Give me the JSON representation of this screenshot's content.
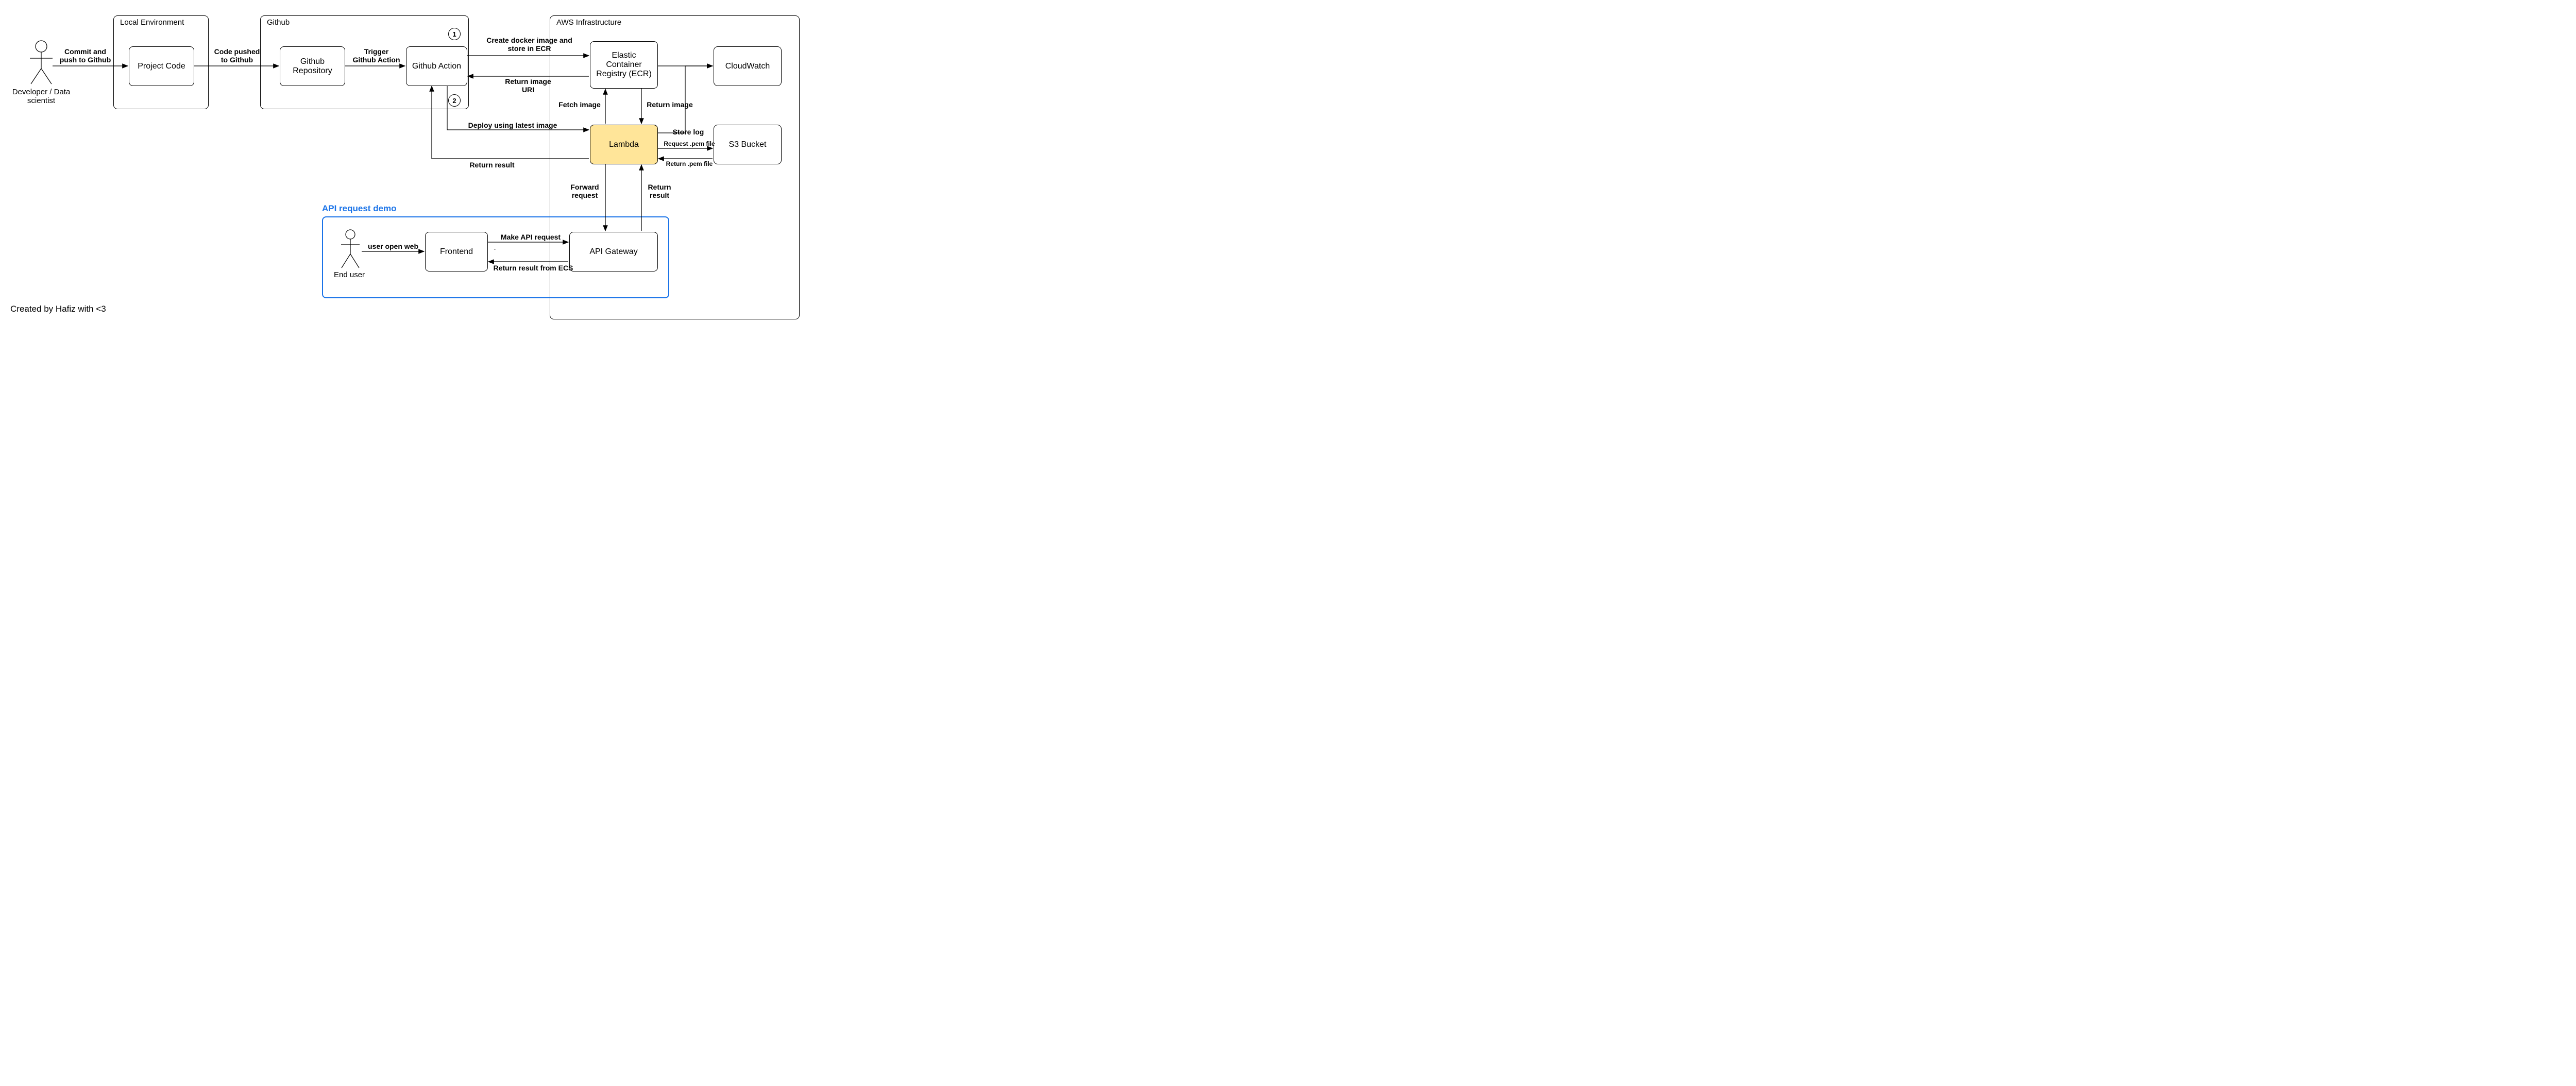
{
  "actors": {
    "developer": "Developer / Data\nscientist",
    "enduser": "End user"
  },
  "groups": {
    "local": "Local Environment",
    "github": "Github",
    "aws": "AWS Infrastructure",
    "api_demo": "API request demo"
  },
  "nodes": {
    "project_code": "Project Code",
    "github_repo": "Github\nRepository",
    "github_action": "Github Action",
    "ecr": "Elastic\nContainer\nRegistry (ECR)",
    "cloudwatch": "CloudWatch",
    "lambda": "Lambda",
    "s3": "S3 Bucket",
    "frontend": "Frontend",
    "api_gateway": "API Gateway",
    "tick": "`"
  },
  "edges": {
    "commit": "Commit and\npush to Github",
    "code_pushed": "Code pushed\nto Github",
    "trigger": "Trigger\nGithub Action",
    "create_img": "Create docker image and\nstore in ECR",
    "return_uri": "Return image\nURI",
    "fetch_img": "Fetch image",
    "return_img": "Return image",
    "deploy": "Deploy using latest image",
    "return_result_ga": "Return result",
    "store_log": "Store log",
    "req_pem": "Request .pem file",
    "ret_pem": "Return .pem file",
    "fwd_req": "Forward\nrequest",
    "ret_result": "Return\nresult",
    "user_open": "user open web",
    "make_api": "Make API request",
    "ret_ecs": "Return result from ECS"
  },
  "steps": {
    "s1": "1",
    "s2": "2"
  },
  "credit": "Created by Hafiz with  <3"
}
